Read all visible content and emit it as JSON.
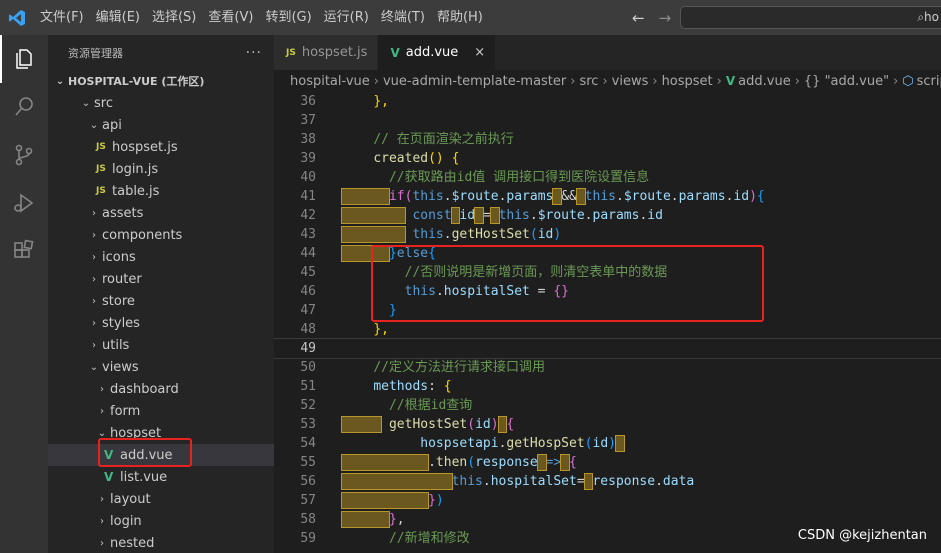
{
  "titlebar": {
    "menu": [
      "文件(F)",
      "编辑(E)",
      "选择(S)",
      "查看(V)",
      "转到(G)",
      "运行(R)",
      "终端(T)",
      "帮助(H)"
    ],
    "back_icon": "←",
    "forward_icon": "→",
    "search_text": "ho"
  },
  "sidebar": {
    "title": "资源管理器",
    "more": "···",
    "workspace": "HOSPITAL-VUE (工作区)",
    "tree": {
      "src": "src",
      "api": "api",
      "hospset_js": "hospset.js",
      "login_js": "login.js",
      "table_js": "table.js",
      "assets": "assets",
      "components": "components",
      "icons": "icons",
      "router": "router",
      "store": "store",
      "styles": "styles",
      "utils": "utils",
      "views": "views",
      "dashboard": "dashboard",
      "form": "form",
      "hospset": "hospset",
      "add_vue": "add.vue",
      "list_vue": "list.vue",
      "layout": "layout",
      "login": "login",
      "nested": "nested"
    },
    "js_badge": "JS",
    "vue_badge": "V"
  },
  "tabs": [
    {
      "label": "hospset.js",
      "badge": "JS",
      "active": false
    },
    {
      "label": "add.vue",
      "badge": "V",
      "active": true,
      "close": "×"
    }
  ],
  "breadcrumb": [
    "hospital-vue",
    "vue-admin-template-master",
    "src",
    "views",
    "hospset",
    "add.vue",
    "{} \"add.vue\"",
    "script",
    "[]"
  ],
  "breadcrumb_sep": "›",
  "editor": {
    "line_numbers": [
      "36",
      "37",
      "38",
      "39",
      "40",
      "41",
      "42",
      "43",
      "44",
      "45",
      "46",
      "47",
      "48",
      "49",
      "50",
      "51",
      "52",
      "53",
      "54",
      "55",
      "56",
      "57",
      "58",
      "59"
    ],
    "current_line": "49"
  },
  "watermark": "CSDN @kejizhentan"
}
